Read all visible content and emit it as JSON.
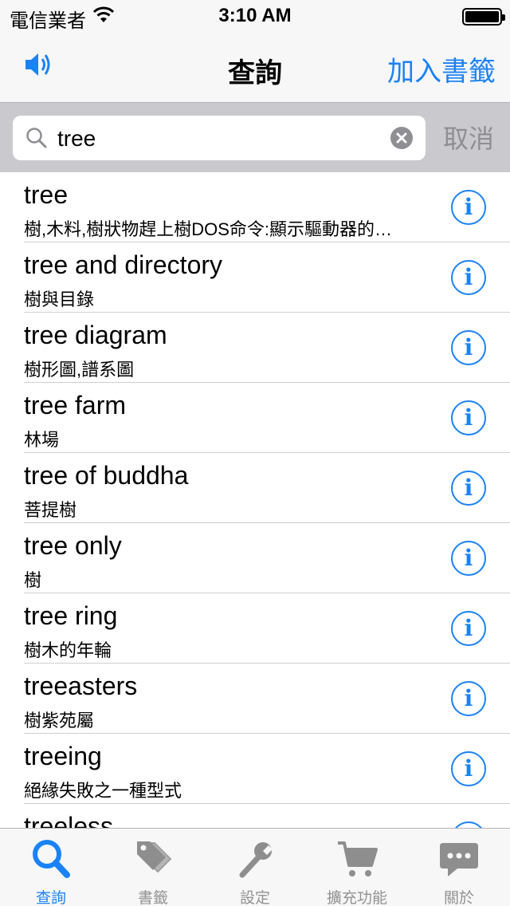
{
  "status_bar": {
    "carrier": "電信業者",
    "time": "3:10 AM",
    "battery_level": 1.0
  },
  "nav": {
    "title": "查詢",
    "bookmark_label": "加入書籤",
    "speaker_icon": "speaker-icon"
  },
  "search": {
    "query": "tree",
    "cancel_label": "取消"
  },
  "results": [
    {
      "word": "tree",
      "definition": "樹,木料,樹狀物趕上樹DOS命令:顯示驅動器的…"
    },
    {
      "word": "tree and directory",
      "definition": "樹與目錄"
    },
    {
      "word": "tree diagram",
      "definition": "樹形圖,譜系圖"
    },
    {
      "word": "tree farm",
      "definition": "林場"
    },
    {
      "word": "tree of buddha",
      "definition": "菩提樹"
    },
    {
      "word": "tree only",
      "definition": "樹"
    },
    {
      "word": "tree ring",
      "definition": "樹木的年輪"
    },
    {
      "word": "treeasters",
      "definition": "樹紫苑屬"
    },
    {
      "word": "treeing",
      "definition": "絕緣失敗之一種型式"
    },
    {
      "word": "treeless",
      "definition": ""
    }
  ],
  "tabs": [
    {
      "label": "查詢",
      "icon": "search-icon",
      "active": true
    },
    {
      "label": "書籤",
      "icon": "tag-icon",
      "active": false
    },
    {
      "label": "設定",
      "icon": "wrench-icon",
      "active": false
    },
    {
      "label": "擴充功能",
      "icon": "cart-icon",
      "active": false
    },
    {
      "label": "關於",
      "icon": "chat-icon",
      "active": false
    }
  ],
  "colors": {
    "accent": "#1a82f7",
    "inactive": "#929292",
    "search_bar_bg": "#c9c9ce"
  }
}
